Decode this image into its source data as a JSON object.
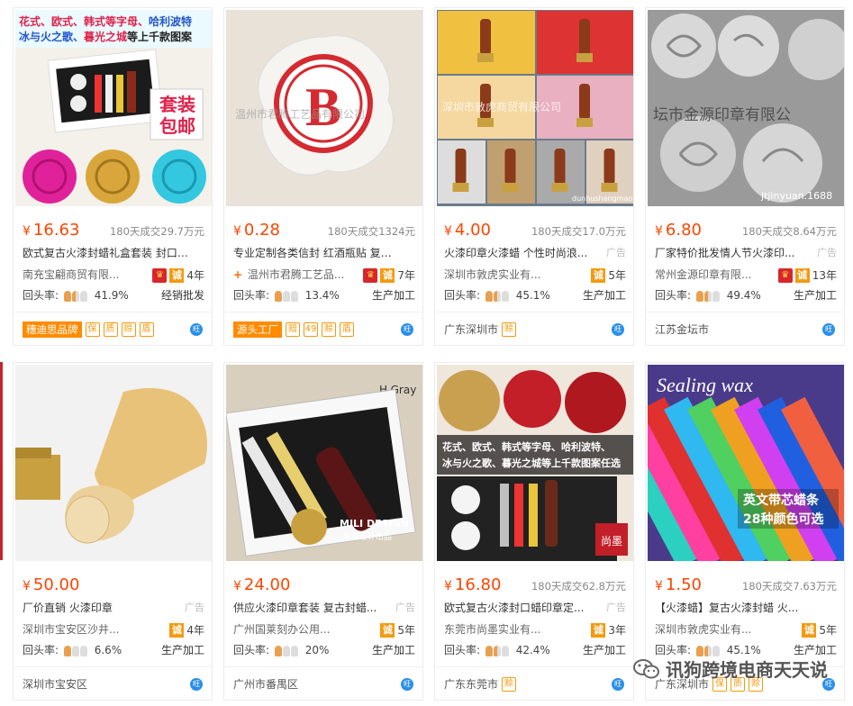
{
  "products": [
    {
      "price": "16.63",
      "deal": "180天成交29.7万元",
      "title": "欧式复古火漆封蜡礼盒套装 封口蜡...",
      "ad": "",
      "shop": "南充宝翩商贸有限...",
      "plus": false,
      "crown": true,
      "years": "4年",
      "repurchase": "41.9%",
      "rating": [
        1,
        0.5,
        0
      ],
      "biz": "经销批发",
      "foot_tag": "穗迪思品牌",
      "foot_minis": [
        "保",
        "质",
        "赊",
        "盾"
      ],
      "location": "",
      "image_text": {
        "line1a": "花式、欧式、",
        "line1b": "韩式等字母、",
        "line1c": "哈利波特",
        "line2a": "冰与火之歌、",
        "line2b": "暮光之城",
        "line2c": "等上千款图案",
        "badge1": "套装",
        "badge2": "包邮"
      }
    },
    {
      "price": "0.28",
      "deal": "180天成交1324元",
      "title": "专业定制各类信封 红酒瓶贴 复古火...",
      "ad": "",
      "shop": "温州市君腾工艺品...",
      "plus": true,
      "crown": true,
      "years": "7年",
      "repurchase": "13.4%",
      "rating": [
        1,
        0,
        0
      ],
      "biz": "生产加工",
      "foot_tag": "源头工厂",
      "foot_minis": [
        "赔",
        "49",
        "赊",
        "盾"
      ],
      "location": "",
      "image_text": {
        "letter": "B",
        "wm": "温州市君腾工艺品有限公司"
      }
    },
    {
      "price": "4.00",
      "deal": "180天成交17.0万元",
      "title": "火漆印章火漆蜡 个性时尚浪...",
      "ad": "广告",
      "shop": "深圳市敦虎实业有...",
      "plus": false,
      "crown": false,
      "years": "5年",
      "repurchase": "45.1%",
      "rating": [
        1,
        0.5,
        0
      ],
      "biz": "生产加工",
      "foot_tag": "",
      "foot_minis": [
        "赊"
      ],
      "location": "广东深圳市",
      "image_text": {
        "wm": "深圳市敦虎商贸有限公司",
        "url": "dunhushangmao.1688.com"
      }
    },
    {
      "price": "6.80",
      "deal": "180天成交8.64万元",
      "title": "厂家特价批发情人节火漆印...",
      "ad": "广告",
      "shop": "常州金源印章有限...",
      "plus": false,
      "crown": true,
      "years": "13年",
      "repurchase": "49.4%",
      "rating": [
        1,
        0.5,
        0
      ],
      "biz": "生产加工",
      "foot_tag": "",
      "foot_minis": [],
      "location": "江苏金坛市",
      "image_text": {
        "wm": "坛市金源印章有限公",
        "url": "jtjinyuan.1688"
      }
    },
    {
      "price": "50.00",
      "deal": "",
      "title": "厂价直销 火漆印章",
      "ad": "广告",
      "shop": "深圳市宝安区沙井...",
      "plus": false,
      "crown": false,
      "years": "4年",
      "repurchase": "6.6%",
      "rating": [
        1,
        0,
        0
      ],
      "biz": "生产加工",
      "foot_tag": "",
      "foot_minis": [],
      "location": "深圳市宝安区",
      "image_text": {}
    },
    {
      "price": "24.00",
      "deal": "",
      "title": "供应火漆印章套装 复古封蜡...",
      "ad": "广告",
      "shop": "广州国莱刻办公用...",
      "plus": false,
      "crown": false,
      "years": "5年",
      "repurchase": "20%",
      "rating": [
        1,
        0,
        0
      ],
      "biz": "生产加工",
      "foot_tag": "",
      "foot_minis": [],
      "location": "广州市番禺区",
      "image_text": {
        "brand": "MILI DESIGN",
        "brand_cn": "米丽设计出品",
        "paper": "H.Gray"
      }
    },
    {
      "price": "16.80",
      "deal": "180天成交62.8万元",
      "title": "欧式复古火漆封口蜡印章定...",
      "ad": "广告",
      "shop": "东莞市尚墨实业有...",
      "plus": false,
      "crown": false,
      "years": "3年",
      "repurchase": "42.4%",
      "rating": [
        1,
        0.5,
        0
      ],
      "biz": "生产加工",
      "foot_tag": "",
      "foot_minis": [
        "赊"
      ],
      "location": "广东东莞市",
      "image_text": {
        "line1": "花式、欧式、韩式等字母、哈利波特、",
        "line2": "冰与火之歌、暮光之城等上千款图案任选",
        "brand": "尚墨"
      }
    },
    {
      "price": "1.50",
      "deal": "180天成交7.63万元",
      "title": "【火漆蜡】复古火漆封蜡 火...",
      "ad": "",
      "shop": "深圳市敦虎实业有...",
      "plus": false,
      "crown": false,
      "years": "5年",
      "repurchase": "45.1%",
      "rating": [
        1,
        0.5,
        0
      ],
      "biz": "生产加工",
      "foot_tag": "",
      "foot_minis": [
        "保",
        "质",
        "赊"
      ],
      "location": "广东深圳市",
      "image_text": {
        "script": "Sealing wax",
        "line1": "英文带芯蜡条",
        "line2": "28种颜色可选"
      }
    }
  ],
  "labels": {
    "currency": "¥",
    "repurchase_label": "回头率:",
    "cheng": "诚",
    "crown": "♛",
    "plus": "+",
    "chat": "旺"
  },
  "watermark": "讯狗跨境电商天天说"
}
